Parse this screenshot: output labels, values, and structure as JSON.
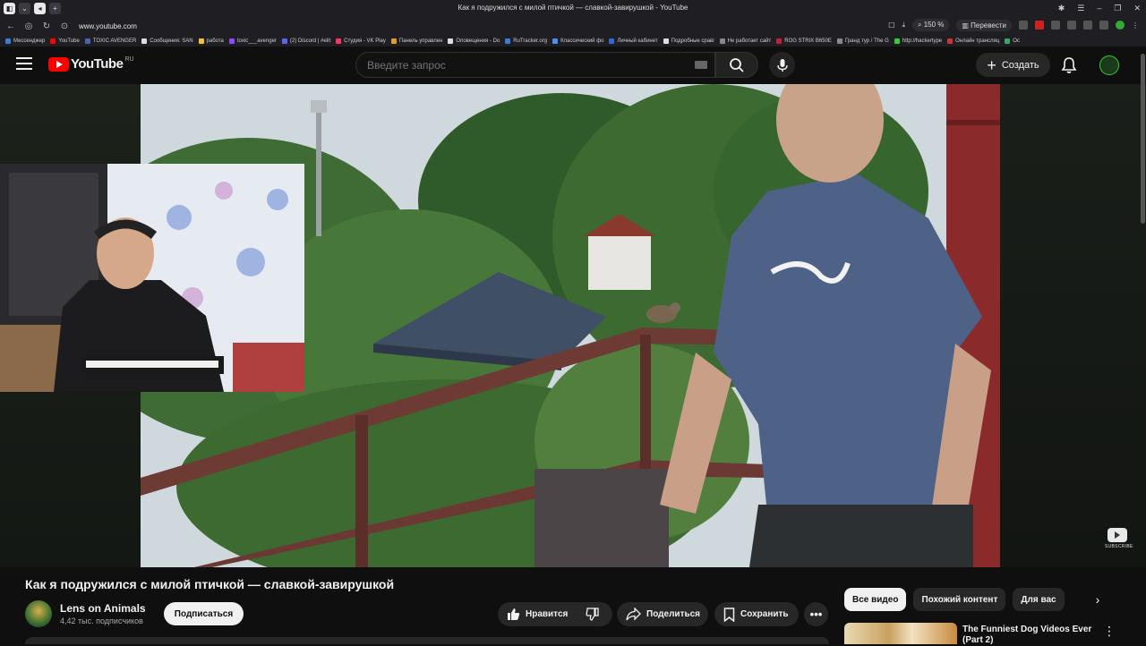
{
  "browser": {
    "window_title": "Как я подружился с милой птичкой — славкой-завирушкой - YouTube",
    "url": "www.youtube.com",
    "zoom": "150 %",
    "translate_label": "Перевести",
    "bookmarks": [
      {
        "label": "Мессенджер",
        "color": "#3a7bd5"
      },
      {
        "label": "YouTube",
        "color": "#ff0000"
      },
      {
        "label": "TOXIC AVENGER",
        "color": "#4466aa"
      },
      {
        "label": "Сообщения: SAN",
        "color": "#dddddd"
      },
      {
        "label": "работа",
        "color": "#f2c230"
      },
      {
        "label": "toxic___avenger",
        "color": "#9146ff"
      },
      {
        "label": "(2) Discord | #elit",
        "color": "#5865f2"
      },
      {
        "label": "Студия - VK Play",
        "color": "#ff3366"
      },
      {
        "label": "Панель управлен",
        "color": "#e39b2b"
      },
      {
        "label": "Оповещения - Do",
        "color": "#dddddd"
      },
      {
        "label": "RuTracker.org",
        "color": "#3a7bd5"
      },
      {
        "label": "Классический фо",
        "color": "#4c8bf5"
      },
      {
        "label": "Личный кабинет",
        "color": "#2a6bd8"
      },
      {
        "label": "Подробные сраві",
        "color": "#dddddd"
      },
      {
        "label": "Не работает сайт",
        "color": "#888888"
      },
      {
        "label": "ROG STRIX B650E",
        "color": "#c41e3a"
      },
      {
        "label": "Гранд тур / The G",
        "color": "#888888"
      },
      {
        "label": "http://hackertype",
        "color": "#33cc33"
      },
      {
        "label": "Онлайн трансляц",
        "color": "#cc3333"
      },
      {
        "label": "Ос",
        "color": "#33aa66"
      }
    ]
  },
  "header": {
    "logo_text": "YouTube",
    "region": "RU",
    "search_placeholder": "Введите запрос",
    "create_label": "Создать"
  },
  "player": {
    "subscribe_watermark": "SUBSCRIBE"
  },
  "video": {
    "title": "Как я подружился с милой птичкой — славкой-завирушкой",
    "channel_name": "Lens on Animals",
    "subscribers": "4,42 тыс. подписчиков",
    "subscribe_label": "Подписаться",
    "like_label": "Нравится",
    "share_label": "Поделиться",
    "save_label": "Сохранить",
    "more_label": "•••"
  },
  "sidebar": {
    "chips": [
      "Все видео",
      "Похожий контент",
      "Для вас"
    ],
    "active_chip": "Все видео",
    "next_recommendation": {
      "title": "The Funniest Dog Videos Ever (Part 2)"
    }
  },
  "colors": {
    "background": "#0f0f0f",
    "accent_red": "#ff0000",
    "pill": "#272727",
    "text": "#f1f1f1",
    "muted": "#aaaaaa"
  }
}
